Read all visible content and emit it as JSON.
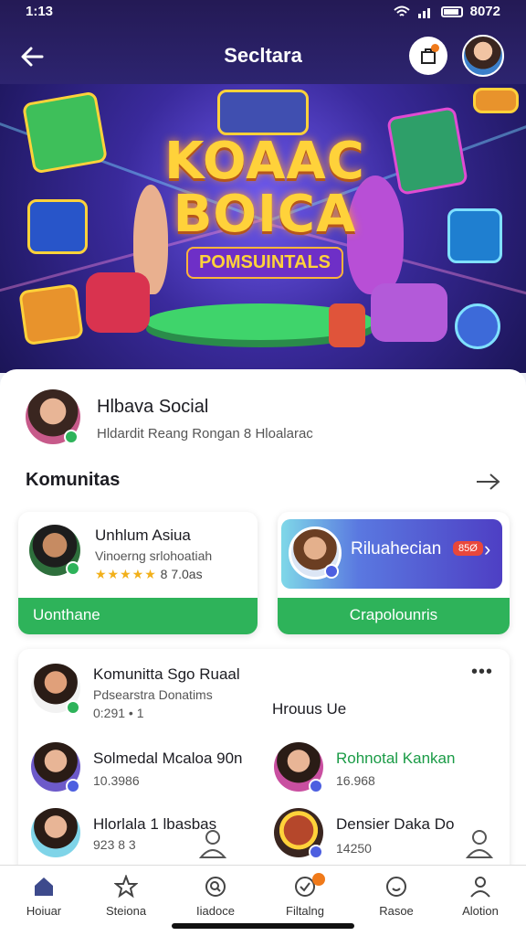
{
  "status_bar": {
    "time": "1:13",
    "battery": "8072"
  },
  "header": {
    "title": "Secltara"
  },
  "banner": {
    "line1": "KOAAC",
    "line2": "BOICA",
    "line3": "POMSUINTALS"
  },
  "profile": {
    "name": "Hlbava Social",
    "subtitle": "Hldardit Reang Rongan 8 Hloalarac"
  },
  "section": {
    "title": "Komunitas"
  },
  "card_a": {
    "name": "Unhlum Asiua",
    "subtitle": "Vinoerng srlohoatiah",
    "rating": "8 7.0as",
    "stars": "★★★★★",
    "button": "Uonthane"
  },
  "card_b": {
    "label": "Riluahecian",
    "pill": "85Ø",
    "button": "Crapolounris"
  },
  "list": {
    "header_name": "Komunitta Sgo Ruaal",
    "header_sub": "Pdsearstra Donatims",
    "header_meta": "0:291 • 1",
    "side_label": "Hrouus Ue",
    "items": [
      {
        "name": "Solmedal Mcaloa 90n",
        "meta": "10.3986"
      },
      {
        "name": "Rohnotal Kankan",
        "meta": "16.968"
      },
      {
        "name": "Hlorlala 1 lbasbas",
        "meta": "923 8 3"
      },
      {
        "name": "Densier Daka Do",
        "meta": "14250"
      }
    ]
  },
  "nav": [
    {
      "label": "Hoiuar"
    },
    {
      "label": "Steiona"
    },
    {
      "label": "Iiadoce"
    },
    {
      "label": "Filtalng"
    },
    {
      "label": "Rasoe"
    },
    {
      "label": "Alotion"
    }
  ],
  "colors": {
    "accent_green": "#2eb35a",
    "header_bg": "#2d2470",
    "badge_orange": "#f07a1a"
  }
}
